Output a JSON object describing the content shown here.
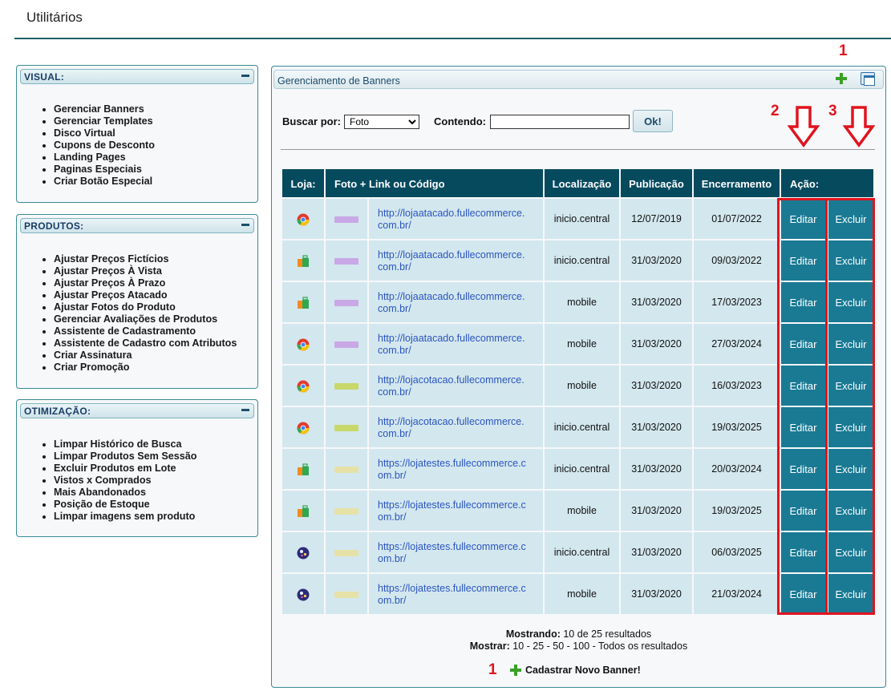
{
  "page_title": "Utilitários",
  "sidebar": [
    {
      "title": "VISUAL:",
      "items": [
        "Gerenciar Banners",
        "Gerenciar Templates",
        "Disco Virtual",
        "Cupons de Desconto",
        "Landing Pages",
        "Paginas Especiais",
        "Criar Botão Especial"
      ]
    },
    {
      "title": "PRODUTOS:",
      "items": [
        "Ajustar Preços Fictícios",
        "Ajustar Preços À Vista",
        "Ajustar Preços À Prazo",
        "Ajustar Preços Atacado",
        "Ajustar Fotos do Produto",
        "Gerenciar Avaliações de Produtos",
        "Assistente de Cadastramento",
        "Assistente de Cadastro com Atributos",
        "Criar Assinatura",
        "Criar Promoção"
      ]
    },
    {
      "title": "OTIMIZAÇÃO:",
      "items": [
        "Limpar Histórico de Busca",
        "Limpar Produtos Sem Sessão",
        "Excluir Produtos em Lote",
        "Vistos x Comprados",
        "Mais Abandonados",
        "Posição de Estoque",
        "Limpar imagens sem produto"
      ]
    }
  ],
  "main": {
    "title": "Gerenciamento de Banners",
    "search": {
      "label": "Buscar por:",
      "selected": "Foto",
      "contains_label": "Contendo:",
      "value": "",
      "ok_label": "Ok!"
    },
    "columns": [
      "Loja:",
      "Foto + Link ou Código",
      "Localização",
      "Publicação",
      "Encerramento",
      "Ação:"
    ],
    "rows": [
      {
        "store_icon": "chrome-icon",
        "thumb_color": "#c9a8e6",
        "link": "http://lojaatacado.fullecommerce.com.br/",
        "link_l1": "http://lojaatacado.fullecommerce.",
        "link_l2": "com.br/",
        "location": "inicio.central",
        "published": "12/07/2019",
        "ends": "01/07/2022",
        "edit": "Editar",
        "delete": "Excluir"
      },
      {
        "store_icon": "bag-icon",
        "thumb_color": "#c9a8e6",
        "link": "http://lojaatacado.fullecommerce.com.br/",
        "link_l1": "http://lojaatacado.fullecommerce.",
        "link_l2": "com.br/",
        "location": "inicio.central",
        "published": "31/03/2020",
        "ends": "09/03/2022",
        "edit": "Editar",
        "delete": "Excluir"
      },
      {
        "store_icon": "bag-icon",
        "thumb_color": "#c9a8e6",
        "link": "http://lojaatacado.fullecommerce.com.br/",
        "link_l1": "http://lojaatacado.fullecommerce.",
        "link_l2": "com.br/",
        "location": "mobile",
        "published": "31/03/2020",
        "ends": "17/03/2023",
        "edit": "Editar",
        "delete": "Excluir"
      },
      {
        "store_icon": "chrome-icon",
        "thumb_color": "#c9a8e6",
        "link": "http://lojaatacado.fullecommerce.com.br/",
        "link_l1": "http://lojaatacado.fullecommerce.",
        "link_l2": "com.br/",
        "location": "mobile",
        "published": "31/03/2020",
        "ends": "27/03/2024",
        "edit": "Editar",
        "delete": "Excluir"
      },
      {
        "store_icon": "chrome-icon",
        "thumb_color": "#c8d86a",
        "link": "http://lojacotacao.fullecommerce.com.br/",
        "link_l1": "http://lojacotacao.fullecommerce.",
        "link_l2": "com.br/",
        "location": "mobile",
        "published": "31/03/2020",
        "ends": "16/03/2023",
        "edit": "Editar",
        "delete": "Excluir"
      },
      {
        "store_icon": "chrome-icon",
        "thumb_color": "#c8d86a",
        "link": "http://lojacotacao.fullecommerce.com.br/",
        "link_l1": "http://lojacotacao.fullecommerce.",
        "link_l2": "com.br/",
        "location": "inicio.central",
        "published": "31/03/2020",
        "ends": "19/03/2025",
        "edit": "Editar",
        "delete": "Excluir"
      },
      {
        "store_icon": "bag-icon",
        "thumb_color": "#e6e1a6",
        "link": "https://lojatestes.fullecommerce.com.br/",
        "link_l1": "https://lojatestes.fullecommerce.c",
        "link_l2": "om.br/",
        "location": "inicio.central",
        "published": "31/03/2020",
        "ends": "20/03/2024",
        "edit": "Editar",
        "delete": "Excluir"
      },
      {
        "store_icon": "bag-icon",
        "thumb_color": "#e6e1a6",
        "link": "https://lojatestes.fullecommerce.com.br/",
        "link_l1": "https://lojatestes.fullecommerce.c",
        "link_l2": "om.br/",
        "location": "mobile",
        "published": "31/03/2020",
        "ends": "19/03/2025",
        "edit": "Editar",
        "delete": "Excluir"
      },
      {
        "store_icon": "globe-icon",
        "thumb_color": "#e6e1a6",
        "link": "https://lojatestes.fullecommerce.com.br/",
        "link_l1": "https://lojatestes.fullecommerce.c",
        "link_l2": "om.br/",
        "location": "inicio.central",
        "published": "31/03/2020",
        "ends": "06/03/2025",
        "edit": "Editar",
        "delete": "Excluir"
      },
      {
        "store_icon": "globe-icon",
        "thumb_color": "#e6e1a6",
        "link": "https://lojatestes.fullecommerce.com.br/",
        "link_l1": "https://lojatestes.fullecommerce.c",
        "link_l2": "om.br/",
        "location": "mobile",
        "published": "31/03/2020",
        "ends": "21/03/2024",
        "edit": "Editar",
        "delete": "Excluir"
      }
    ],
    "showing_label": "Mostrando:",
    "showing_value": "10 de 25 resultados",
    "show_label": "Mostrar:",
    "show_options": "10 - 25 - 50 - 100 - Todos os  resultados",
    "new_banner_label": "Cadastrar Novo Banner!"
  },
  "annotations": {
    "top_number": "1",
    "arrow_edit_number": "2",
    "arrow_delete_number": "3",
    "bottom_number": "1",
    "color": "#e0141e"
  }
}
